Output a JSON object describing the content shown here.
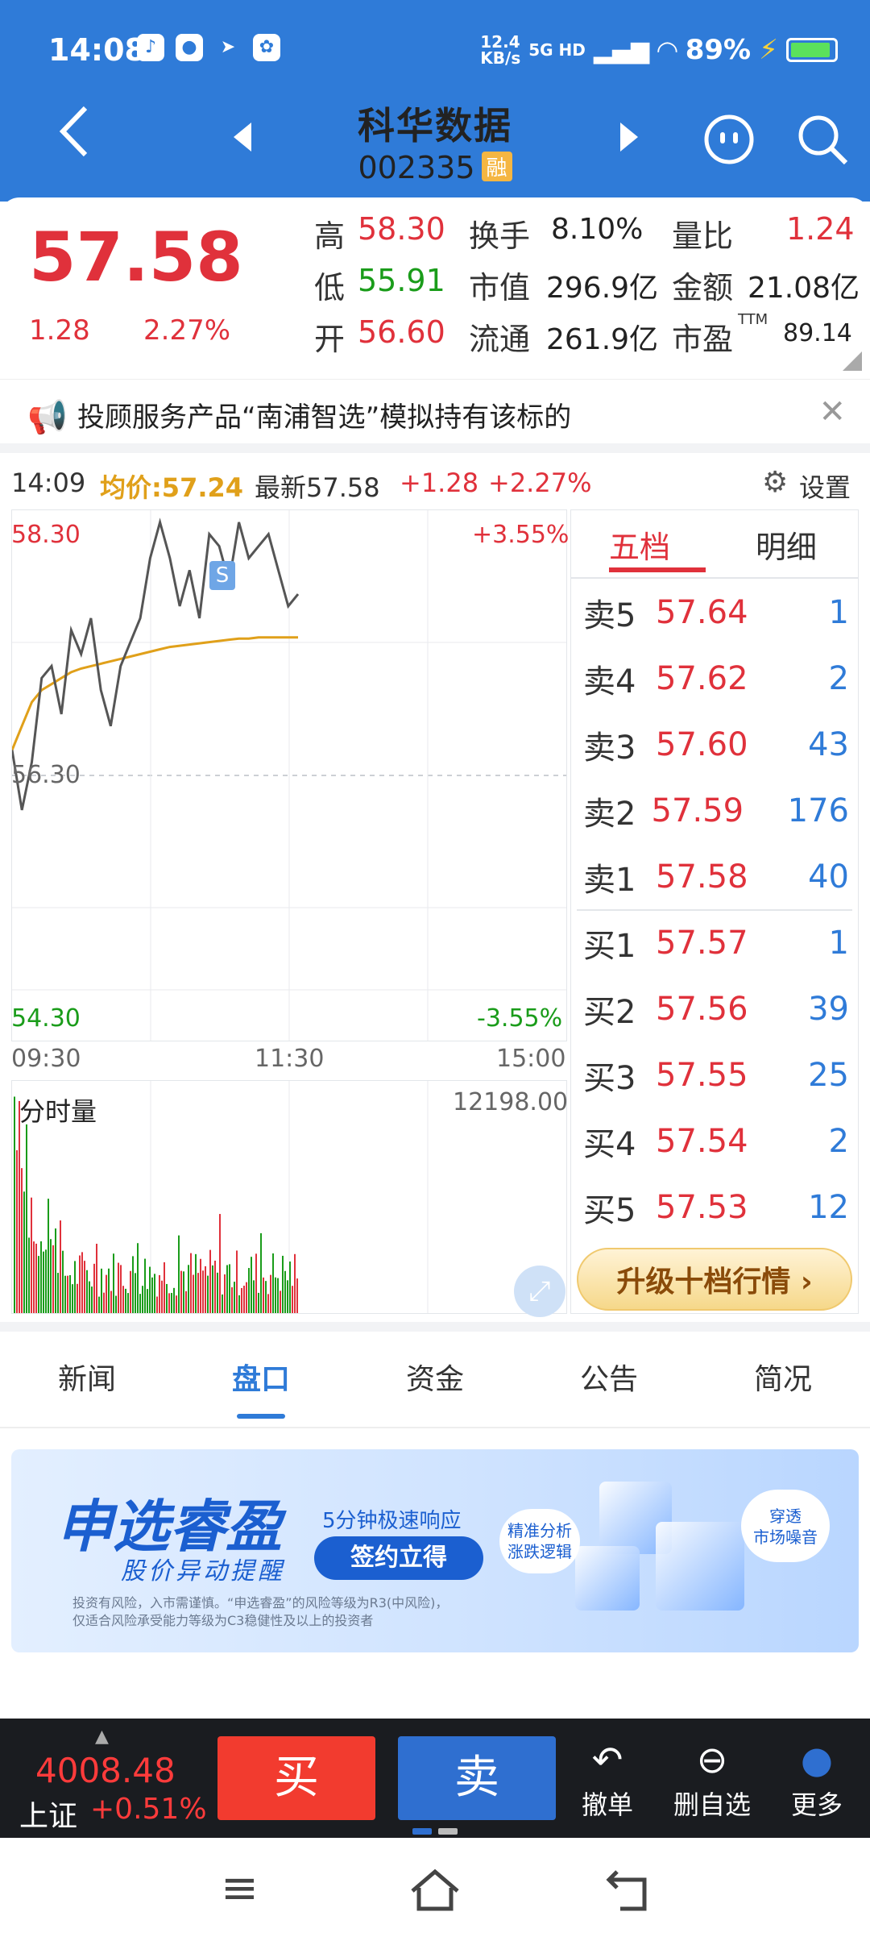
{
  "status_bar": {
    "time": "14:08",
    "net_speed": "12.4 KB/s",
    "network": "5G HD",
    "battery": "89%",
    "icons": [
      "tiktok-icon",
      "app-icon",
      "send-icon",
      "baidu-icon"
    ]
  },
  "header": {
    "stock_name": "科华数据",
    "stock_code": "002335",
    "badge": "融",
    "back_icon": "back-arrow-icon",
    "prev_icon": "prev-stock-icon",
    "next_icon": "next-stock-icon",
    "robot_icon": "robot-icon",
    "search_icon": "search-icon"
  },
  "quote": {
    "price": "57.58",
    "change": "1.28",
    "change_pct": "2.27%",
    "high_label": "高",
    "high": "58.30",
    "low_label": "低",
    "low": "55.91",
    "open_label": "开",
    "open": "56.60",
    "turnover_label": "换手",
    "turnover": "8.10%",
    "mktcap_label": "市值",
    "mktcap": "296.9亿",
    "float_label": "流通",
    "float": "261.9亿",
    "vol_ratio_label": "量比",
    "vol_ratio": "1.24",
    "amount_label": "金额",
    "amount": "21.08亿",
    "pe_label": "市盈",
    "pe_sup": "TTM",
    "pe": "89.14"
  },
  "notice": {
    "text": "投顾服务产品“南浦智选”模拟持有该标的",
    "close": "✕"
  },
  "intraday": {
    "time": "14:09",
    "avg_label": "均价:57.24",
    "latest_label": "最新57.58",
    "chg": "+1.28",
    "chg_pct": "+2.27%",
    "settings_label": "设置",
    "upper_price": "58.30",
    "upper_pct": "+3.55%",
    "mid_price": "56.30",
    "lower_price": "54.30",
    "lower_pct": "-3.55%",
    "time_start": "09:30",
    "time_mid": "11:30",
    "time_end": "15:00",
    "volume_label": "分时量",
    "volume_max": "12198.00",
    "marker": "S"
  },
  "orderbook": {
    "tab_five": "五档",
    "tab_detail": "明细",
    "asks": [
      {
        "label": "卖5",
        "price": "57.64",
        "qty": "1"
      },
      {
        "label": "卖4",
        "price": "57.62",
        "qty": "2"
      },
      {
        "label": "卖3",
        "price": "57.60",
        "qty": "43"
      },
      {
        "label": "卖2",
        "price": "57.59",
        "qty": "176"
      },
      {
        "label": "卖1",
        "price": "57.58",
        "qty": "40"
      }
    ],
    "bids": [
      {
        "label": "买1",
        "price": "57.57",
        "qty": "1"
      },
      {
        "label": "买2",
        "price": "57.56",
        "qty": "39"
      },
      {
        "label": "买3",
        "price": "57.55",
        "qty": "25"
      },
      {
        "label": "买4",
        "price": "57.54",
        "qty": "2"
      },
      {
        "label": "买5",
        "price": "57.53",
        "qty": "12"
      }
    ],
    "upgrade_label": "升级十档行情 ›"
  },
  "tabs": [
    "新闻",
    "盘口",
    "资金",
    "公告",
    "简况"
  ],
  "active_tab": 1,
  "banner": {
    "title": "申选睿盈",
    "subtitle": "股价异动提醒",
    "tagline": "5分钟极速响应",
    "button": "签约立得",
    "bubble1_line1": "精准分析",
    "bubble1_line2": "涨跌逻辑",
    "bubble2_line1": "穿透",
    "bubble2_line2": "市场噪音",
    "disclaimer1": "投资有风险，入市需谨慎。“申选睿盈”的风险等级为R3(中风险)，",
    "disclaimer2": "仅适合风险承受能力等级为C3稳健性及以上的投资者"
  },
  "tradebar": {
    "index_value": "4008.48",
    "index_name": "上证",
    "index_chg": "+0.51%",
    "buy": "买",
    "sell": "卖",
    "cancel_label": "撤单",
    "remove_label": "删自选",
    "more_label": "更多"
  },
  "chart_data": {
    "type": "line",
    "series": [
      {
        "values": [
          56.3,
          55.8,
          56.2,
          56.9,
          57.0,
          56.6,
          57.3,
          57.1,
          57.4,
          56.8,
          56.5,
          57.0,
          57.2,
          57.4,
          57.9,
          58.2,
          57.9,
          57.5,
          57.8,
          57.4,
          58.1,
          58.0,
          57.7,
          58.2,
          57.9,
          58.0,
          58.1,
          57.8,
          57.5,
          57.6
        ]
      },
      {
        "values": [
          56.3,
          56.5,
          56.7,
          56.8,
          56.85,
          56.9,
          56.95,
          56.98,
          57.0,
          57.02,
          57.04,
          57.06,
          57.08,
          57.1,
          57.12,
          57.14,
          57.16,
          57.17,
          57.18,
          57.19,
          57.2,
          57.21,
          57.22,
          57.23,
          57.23,
          57.24,
          57.24,
          57.24,
          57.24,
          57.24
        ]
      }
    ],
    "ylim": [
      54.3,
      58.3
    ]
  }
}
